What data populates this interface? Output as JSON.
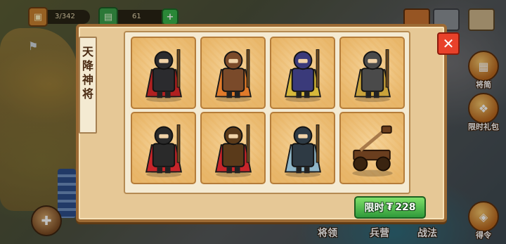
{
  "hud": {
    "gold_count": "3/342",
    "cash_count": "61",
    "chest_icon": "chest-icon",
    "money_icon": "money-icon",
    "add_icon": "plus-icon"
  },
  "side_buttons": [
    {
      "label": "将简",
      "icon": "scroll-icon"
    },
    {
      "label": "限时礼包",
      "icon": "gift-icon"
    },
    {
      "label": "得令",
      "icon": "command-icon"
    }
  ],
  "bottom_nav": [
    "将领",
    "兵营",
    "战法"
  ],
  "popup": {
    "title_chars": [
      "天",
      "降",
      "神",
      "将"
    ],
    "close_label": "✕",
    "buy_label": "限时",
    "price_symbol": "₮",
    "price": "228"
  },
  "units": [
    {
      "name": "black-armored-general",
      "color": "#2b2b2e",
      "accent": "#b02020"
    },
    {
      "name": "shield-axe-warrior",
      "color": "#7a4a2a",
      "accent": "#e07a2a"
    },
    {
      "name": "white-haired-cavalry-general",
      "color": "#3a3a7a",
      "accent": "#d6b83a"
    },
    {
      "name": "spiked-heavy-armor-warrior",
      "color": "#4a4a4a",
      "accent": "#c9a23a"
    },
    {
      "name": "red-cloak-blade-general",
      "color": "#2a2a2a",
      "accent": "#c8252a"
    },
    {
      "name": "archer-general-with-quiver",
      "color": "#5a3a1a",
      "accent": "#c8252a"
    },
    {
      "name": "panther-rider-general",
      "color": "#2e3a44",
      "accent": "#8fb6c8"
    },
    {
      "name": "siege-catapult",
      "color": "#6a3e1e",
      "accent": "#a87a4a"
    }
  ],
  "colors": {
    "panel_bg": "#e6c896",
    "close_red": "#e8412a",
    "buy_green": "#2f9a3a"
  }
}
